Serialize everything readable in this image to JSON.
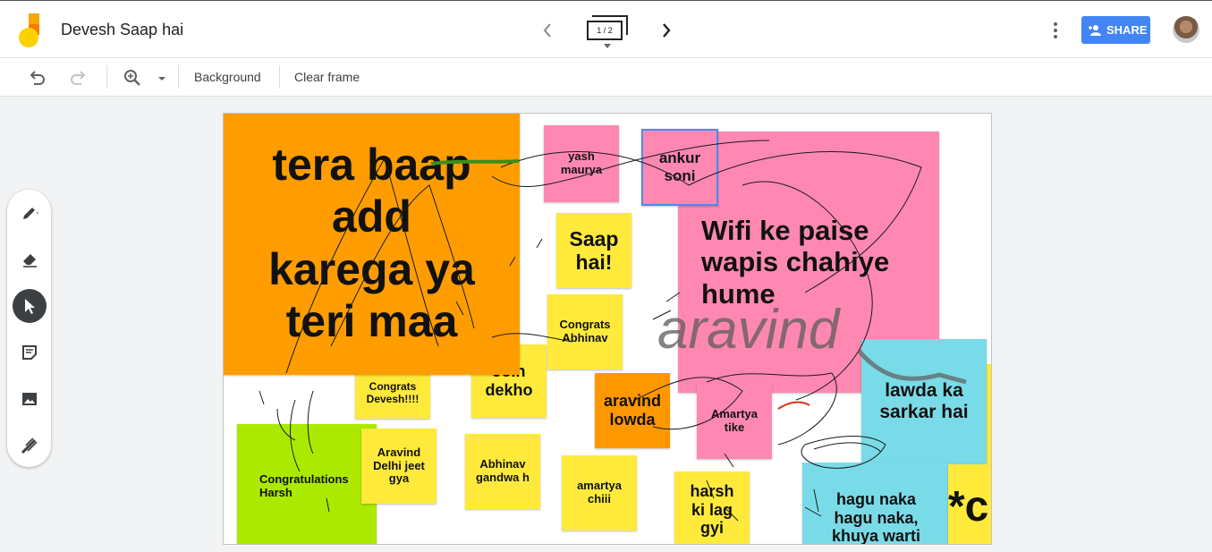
{
  "app": {
    "title": "Devesh Saap hai",
    "frame_indicator": "1 / 2"
  },
  "header": {
    "share_label": "SHARE"
  },
  "toolbar": {
    "background_label": "Background",
    "clear_label": "Clear frame"
  },
  "colors": {
    "accent": "#4285f4",
    "orange": "#ff9d00",
    "pink": "#ff88b3",
    "yellow": "#ffea3b",
    "cyan": "#7adbe8",
    "lime": "#abea00",
    "dark_orange": "#ff9800"
  },
  "canvas": {
    "notes": [
      {
        "text": "tera baap\nadd\nkarega ya\nteri maa"
      },
      {
        "text": "yash\nmaurya"
      },
      {
        "text": "ankur\nsoni"
      },
      {
        "text": "Wifi ke paise\nwapis chahiye\nhume"
      },
      {
        "text": "Saap\nhai!"
      },
      {
        "text": "Congrats\nAbhinav"
      },
      {
        "text": "Congrats\nDevesh!!!!"
      },
      {
        "text": "Join\ndekho"
      },
      {
        "text": "aravind\nlowda"
      },
      {
        "text": "Amartya\ntike"
      },
      {
        "text": "lawda ka\nsarkar hai"
      },
      {
        "text": "Congratulations\nHarsh"
      },
      {
        "text": "Aravind\nDelhi jeet\ngya"
      },
      {
        "text": "Abhinav\ngandwa h"
      },
      {
        "text": "amartya\nchiii"
      },
      {
        "text": "harsh\nki lag\ngyi"
      },
      {
        "text": "hagu naka\nhagu naka,\nkhuya warti"
      },
      {
        "text": "*c"
      }
    ],
    "handwriting": "aravind"
  }
}
